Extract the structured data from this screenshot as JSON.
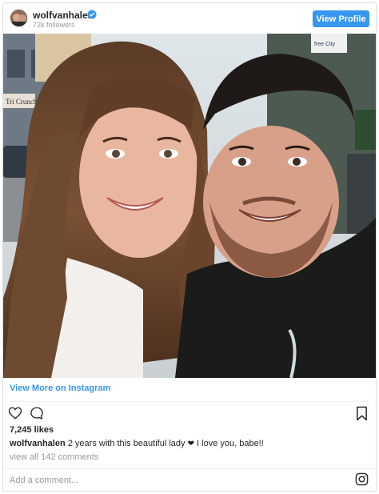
{
  "header": {
    "username": "wolfvanhalen",
    "followers": "72k followers",
    "view_profile_label": "View Profile",
    "verified_icon": "verified-badge-icon",
    "accent_color": "#3897f0"
  },
  "post": {
    "photo_description_icon": "couple-selfie-photo",
    "street_sign_text": "free City",
    "shop_sign_text": "Tri Crunch",
    "view_more_label": "View More on Instagram",
    "likes": "7,245 likes",
    "caption_user": "wolfvanhalen",
    "caption_text": "2 years with this beautiful lady",
    "caption_heart": "❤",
    "caption_tail": "I love you, babe!!",
    "view_comments": "view all 142 comments",
    "add_comment_placeholder": "Add a comment..."
  },
  "icons": {
    "like": "heart-icon",
    "comment": "comment-icon",
    "save": "bookmark-icon",
    "brand": "instagram-glyph-icon"
  }
}
